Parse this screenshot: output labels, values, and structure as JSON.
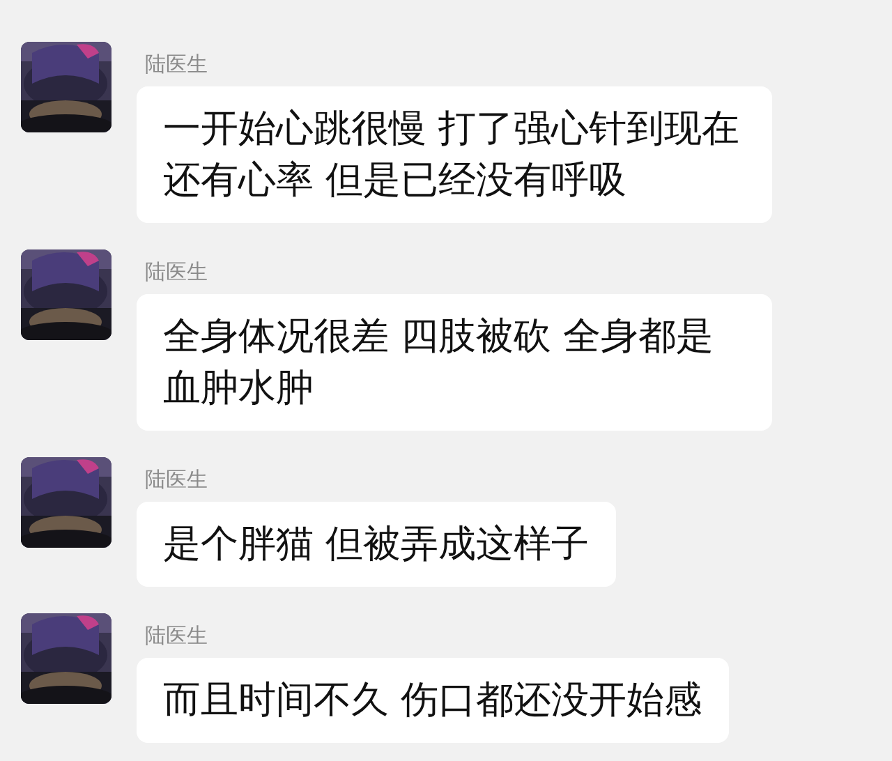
{
  "messages": [
    {
      "sender": "陆医生",
      "text": "一开始心跳很慢 打了强心针到现在还有心率 但是已经没有呼吸"
    },
    {
      "sender": "陆医生",
      "text": "全身体况很差 四肢被砍 全身都是血肿水肿"
    },
    {
      "sender": "陆医生",
      "text": "是个胖猫 但被弄成这样子"
    },
    {
      "sender": "陆医生",
      "text": "而且时间不久 伤口都还没开始感"
    }
  ]
}
